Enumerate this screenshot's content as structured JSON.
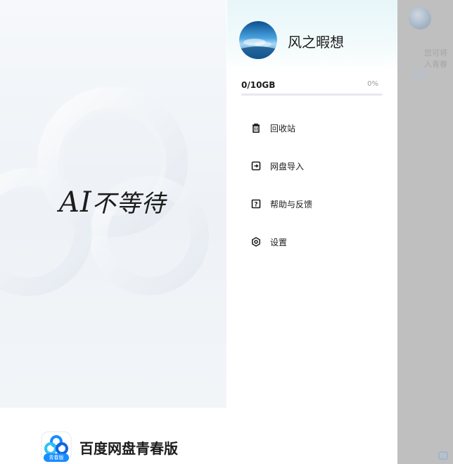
{
  "splash": {
    "slogan_ai": "AI",
    "slogan_rest": "不等待",
    "brand_name": "百度网盘青春版",
    "brand_badge": "青春版"
  },
  "drawer": {
    "username": "风之暇想",
    "storage": {
      "used_text": "0/10GB",
      "percent_text": "0%",
      "fill_fraction": 0.0
    },
    "menu": [
      {
        "label": "回收站",
        "icon": "trash-icon"
      },
      {
        "label": "网盘导入",
        "icon": "import-icon"
      },
      {
        "label": "帮助与反馈",
        "icon": "help-icon"
      },
      {
        "label": "设置",
        "icon": "settings-icon"
      }
    ]
  },
  "background": {
    "hint_line1": "您可将",
    "hint_line2": "入青春"
  },
  "colors": {
    "accent": "#2b7bf6",
    "overlay": "#bfbfbf",
    "text": "#1c1c1c",
    "muted": "#9a9a9a"
  }
}
